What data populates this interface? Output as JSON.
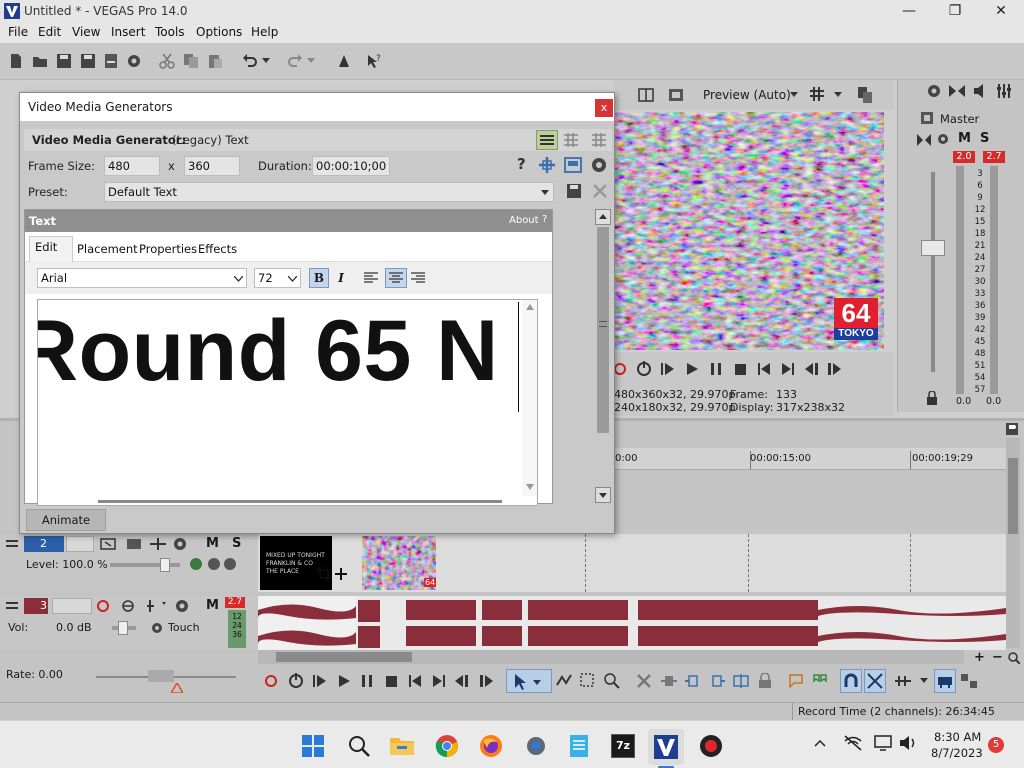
{
  "app": {
    "title": "Untitled * - VEGAS Pro 14.0",
    "window_controls": [
      "minimize",
      "restore",
      "close"
    ]
  },
  "menu": [
    "File",
    "Edit",
    "View",
    "Insert",
    "Tools",
    "Options",
    "Help"
  ],
  "dialog": {
    "title": "Video Media Generators",
    "close_label": "x",
    "generator_label": "Video Media Generator:",
    "generator_value": "(Legacy) Text",
    "frame_size_label": "Frame Size:",
    "frame_width": "480",
    "frame_x": "x",
    "frame_height": "360",
    "duration_label": "Duration:",
    "duration_value": "00:00:10;00",
    "preset_label": "Preset:",
    "preset_value": "Default Text",
    "help_label": "?",
    "panel_title": "Text",
    "about_label": "About",
    "about_icon": "?",
    "tabs": [
      "Edit",
      "Placement",
      "Properties",
      "Effects"
    ],
    "active_tab": "Edit",
    "font_name": "Arial",
    "font_size": "72",
    "bold_label": "B",
    "italic_label": "I",
    "text_content": "Round 65 N",
    "animate_label": "Animate"
  },
  "preview": {
    "quality": "Preview (Auto)",
    "project_info": "480x360x32, 29.970p",
    "preview_info": "240x180x32, 29.970p",
    "frame_label": "Frame:",
    "frame_value": "133",
    "display_label": "Display:",
    "display_value": "317x238x32",
    "logo_number": "64",
    "logo_city": "TOKYO"
  },
  "master": {
    "label": "Master",
    "mute": "M",
    "solo": "S",
    "peak_left": "2.0",
    "peak_right": "2.7",
    "scale": [
      "3",
      "6",
      "9",
      "12",
      "15",
      "18",
      "21",
      "24",
      "27",
      "30",
      "33",
      "36",
      "39",
      "42",
      "45",
      "48",
      "51",
      "54",
      "57"
    ],
    "bottom_left": "0.0",
    "bottom_right": "0.0"
  },
  "timeline": {
    "ruler_marks": [
      "0:00",
      "00:00:15:00",
      "00:00:19;29"
    ],
    "video_track": {
      "number": "2",
      "mute": "M",
      "solo": "S",
      "level": "Level: 100.0 %"
    },
    "audio_track": {
      "number": "3",
      "mute": "M",
      "solo": "S",
      "volume_label": "Vol:",
      "volume_value": "0.0 dB",
      "automation": "Touch",
      "peak": "2.7",
      "meter_values": [
        "12",
        "24",
        "36"
      ]
    },
    "clip_badge": "64",
    "thumbnail_lines": [
      "MIXED UP TONIGHT",
      "FRANKLIN & CO",
      "THE PLACE"
    ],
    "rate": "Rate: 0.00"
  },
  "status": {
    "record_time": "Record Time (2 channels): 26:34:45"
  },
  "taskbar": {
    "time": "8:30 AM",
    "date": "8/7/2023",
    "notifications": "5",
    "zip_label": "7z"
  },
  "colors": {
    "accent_red": "#d63434",
    "audio_wave": "#8b2e3c",
    "dialog_bg": "#c9c9c9"
  }
}
